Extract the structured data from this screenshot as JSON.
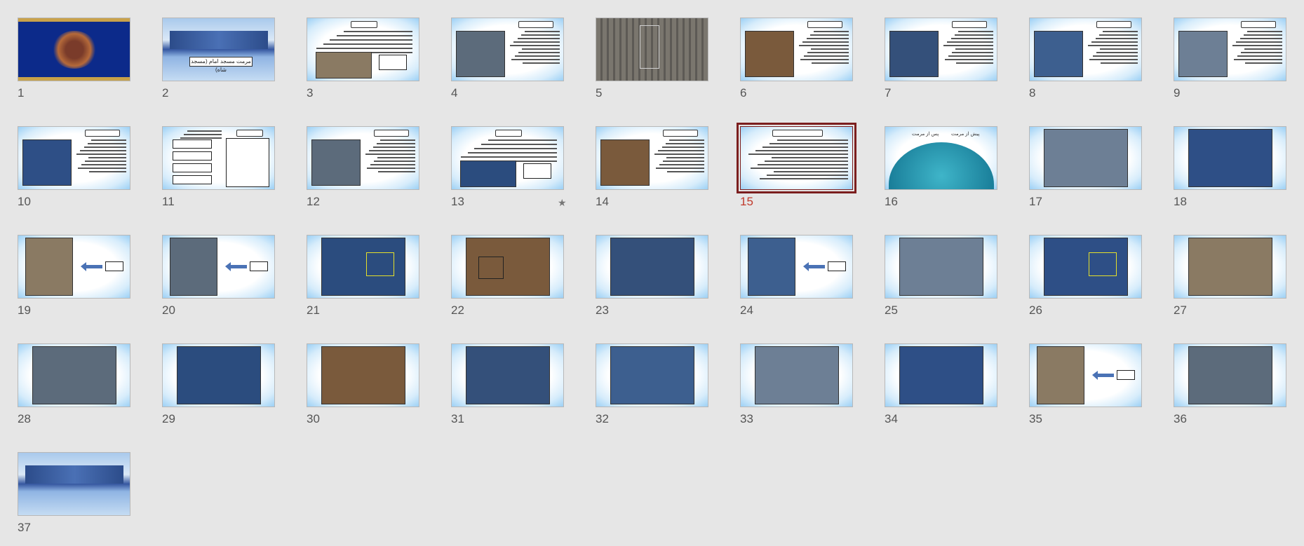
{
  "slide_sorter": {
    "selected": "15",
    "slides": [
      {
        "n": "1"
      },
      {
        "n": "2",
        "caption": "مرمت مسجد امام (مسجد شاه)"
      },
      {
        "n": "3"
      },
      {
        "n": "4"
      },
      {
        "n": "5"
      },
      {
        "n": "6"
      },
      {
        "n": "7"
      },
      {
        "n": "8"
      },
      {
        "n": "9"
      },
      {
        "n": "10"
      },
      {
        "n": "11"
      },
      {
        "n": "12"
      },
      {
        "n": "13",
        "star": "★"
      },
      {
        "n": "14"
      },
      {
        "n": "15"
      },
      {
        "n": "16",
        "label_left": "پس از مرمت",
        "label_right": "پیش از مرمت"
      },
      {
        "n": "17"
      },
      {
        "n": "18"
      },
      {
        "n": "19"
      },
      {
        "n": "20"
      },
      {
        "n": "21"
      },
      {
        "n": "22"
      },
      {
        "n": "23"
      },
      {
        "n": "24"
      },
      {
        "n": "25"
      },
      {
        "n": "26"
      },
      {
        "n": "27"
      },
      {
        "n": "28"
      },
      {
        "n": "29"
      },
      {
        "n": "30"
      },
      {
        "n": "31"
      },
      {
        "n": "32"
      },
      {
        "n": "33"
      },
      {
        "n": "34"
      },
      {
        "n": "35"
      },
      {
        "n": "36"
      },
      {
        "n": "37"
      }
    ]
  },
  "colors": {
    "selected_border": "#7b1e1e",
    "selected_number": "#c0392b",
    "arrow": "#4a72b5"
  }
}
